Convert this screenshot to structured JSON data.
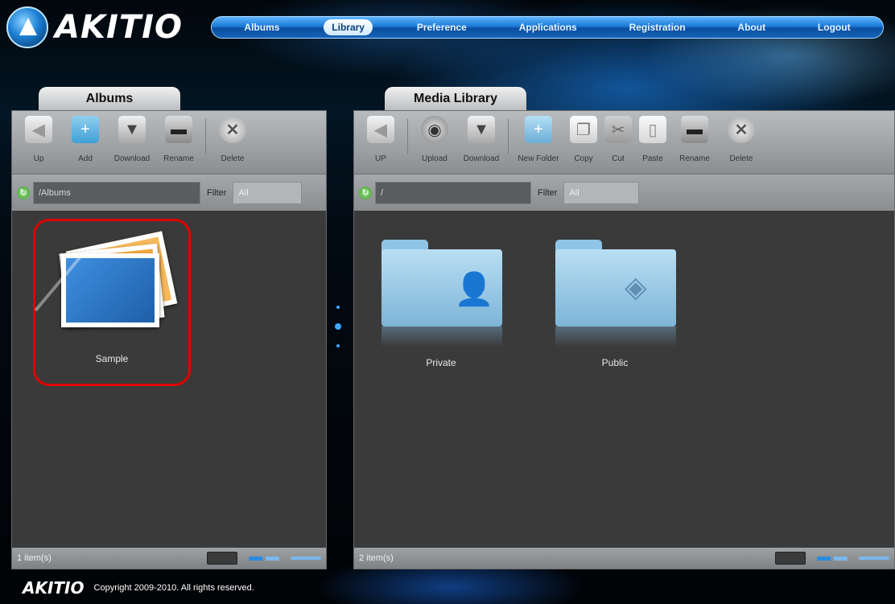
{
  "brand": {
    "name": "AKITIO"
  },
  "nav": {
    "items": [
      {
        "label": "Albums"
      },
      {
        "label": "Library",
        "active": true
      },
      {
        "label": "Preference"
      },
      {
        "label": "Applications"
      },
      {
        "label": "Registration"
      },
      {
        "label": "About"
      },
      {
        "label": "Logout"
      }
    ]
  },
  "albums_panel": {
    "tab_label": "Albums",
    "toolbar": {
      "up": "Up",
      "add": "Add",
      "download": "Download",
      "rename": "Rename",
      "delete": "Delete"
    },
    "path_value": "/Albums",
    "filter_label": "Filter",
    "filter_value": "All",
    "items": [
      {
        "label": "Sample"
      }
    ],
    "status": "1 item(s)"
  },
  "library_panel": {
    "tab_label": "Media Library",
    "toolbar": {
      "up": "UP",
      "upload": "Upload",
      "download": "Download",
      "new_folder": "New Folder",
      "copy": "Copy",
      "cut": "Cut",
      "paste": "Paste",
      "rename": "Rename",
      "delete": "Delete"
    },
    "path_value": "/",
    "filter_label": "Filter",
    "filter_value": "All",
    "items": [
      {
        "label": "Private"
      },
      {
        "label": "Public"
      }
    ],
    "status": "2 item(s)"
  },
  "footer": {
    "logo": "AKITIO",
    "copyright": "Copyright 2009-2010. All rights reserved."
  },
  "colors": {
    "nav_blue": "#1a79d6",
    "highlight_red": "#e00000",
    "panel_dark": "#3a3a3a"
  }
}
